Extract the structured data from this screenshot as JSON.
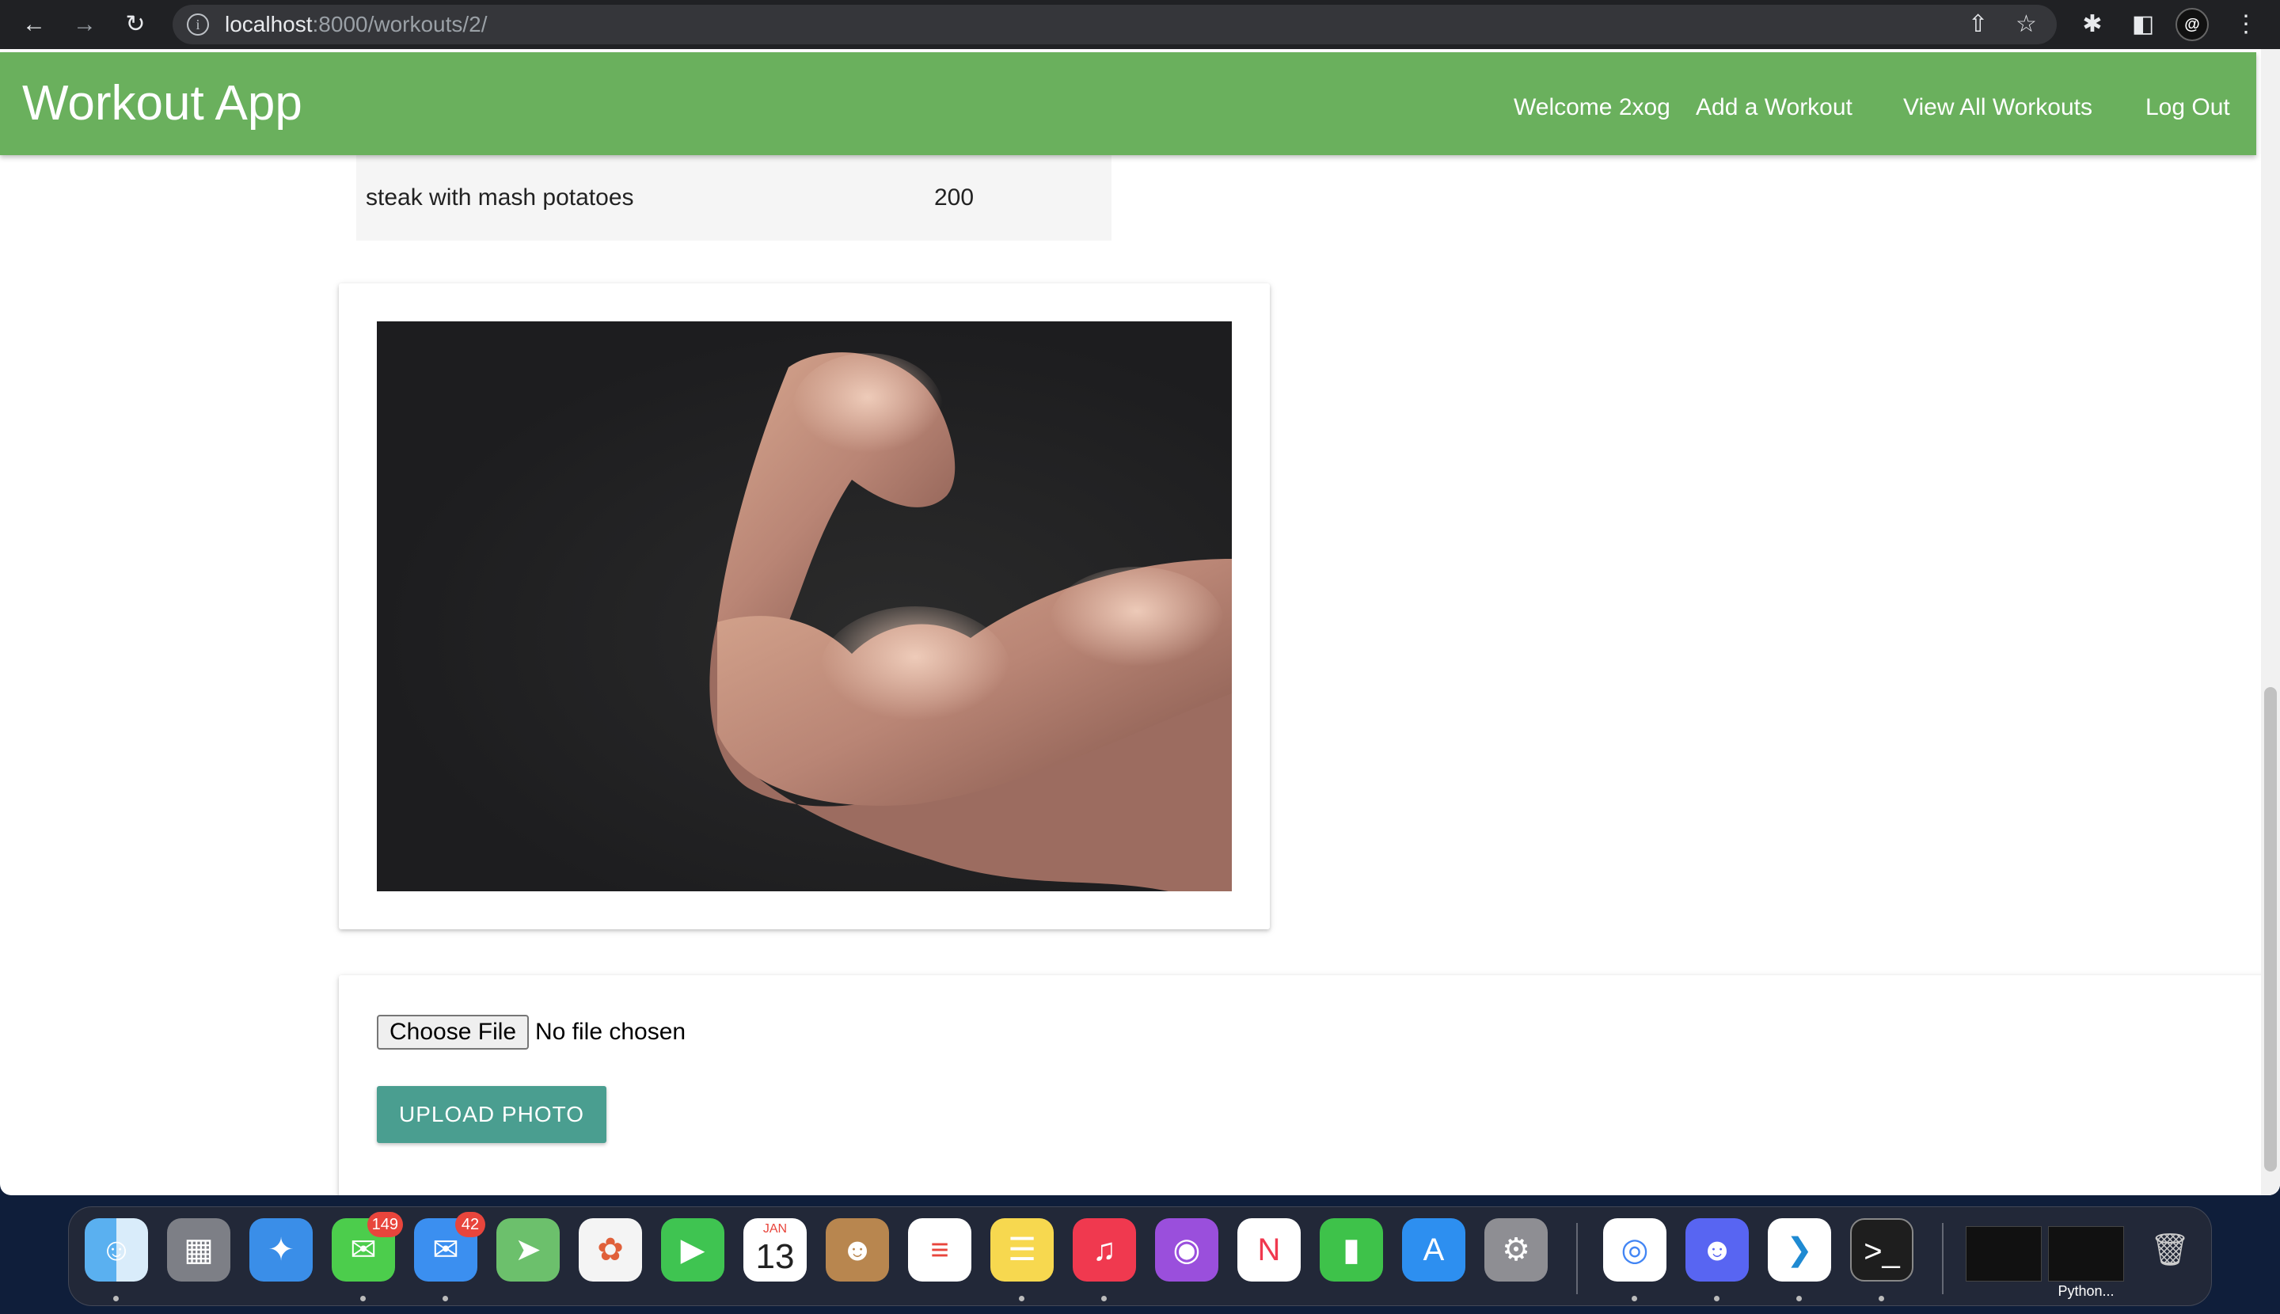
{
  "browser": {
    "url_host": "localhost",
    "url_rest": ":8000/workouts/2/"
  },
  "navbar": {
    "brand": "Workout App",
    "welcome": "Welcome 2xog",
    "add_workout": "Add a Workout",
    "view_all": "View All Workouts",
    "logout": "Log Out"
  },
  "meals": [
    {
      "name": "steak with mash potatoes",
      "calories": "200"
    }
  ],
  "upload": {
    "choose_file_label": "Choose File",
    "file_status": "No file chosen",
    "button_label": "UPLOAD PHOTO"
  },
  "dock": {
    "calendar_month": "JAN",
    "calendar_day": "13",
    "messages_badge": "149",
    "mail_badge": "42",
    "thumb_label": "Python..."
  },
  "colors": {
    "navbar": "#6ab05d",
    "upload_button": "#4a9e90"
  }
}
